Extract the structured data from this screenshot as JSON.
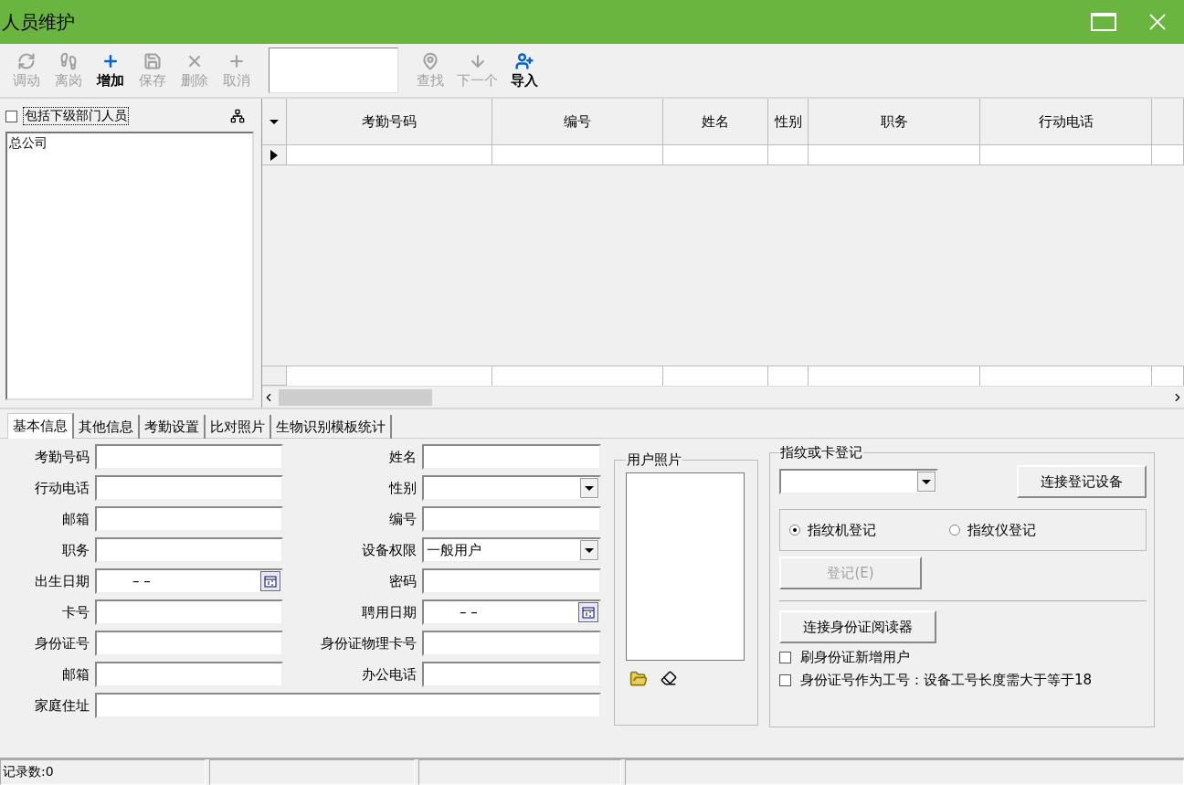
{
  "window": {
    "title": "人员维护"
  },
  "toolbar": {
    "buttons": [
      {
        "label": "调动",
        "disabled": true
      },
      {
        "label": "离岗",
        "disabled": true
      },
      {
        "label": "增加",
        "disabled": false
      },
      {
        "label": "保存",
        "disabled": true
      },
      {
        "label": "删除",
        "disabled": true
      },
      {
        "label": "取消",
        "disabled": true
      }
    ],
    "buttons_after_search": [
      {
        "label": "查找",
        "disabled": true
      },
      {
        "label": "下一个",
        "disabled": true
      },
      {
        "label": "导入",
        "disabled": false
      }
    ]
  },
  "department": {
    "include_sub": {
      "label": "包括下级部门人员",
      "checked": false
    },
    "tree": [
      {
        "label": "总公司",
        "selected": false
      }
    ]
  },
  "table": {
    "columns": [
      "考勤号码",
      "编号",
      "姓名",
      "性别",
      "职务",
      "行动电话"
    ],
    "rows": [
      {
        "selected": true
      }
    ]
  },
  "tabs": [
    {
      "label": "基本信息",
      "selected": true
    },
    {
      "label": "其他信息",
      "selected": false
    },
    {
      "label": "考勤设置",
      "selected": false
    },
    {
      "label": "比对照片",
      "selected": false
    },
    {
      "label": "生物识别模板统计",
      "selected": false
    }
  ],
  "form": {
    "fields": [
      {
        "label": "考勤号码",
        "kind": "text"
      },
      {
        "label": "姓名",
        "kind": "text"
      },
      {
        "label": "行动电话",
        "kind": "text"
      },
      {
        "label": "性别",
        "kind": "select"
      },
      {
        "label": "邮箱",
        "kind": "text"
      },
      {
        "label": "编号",
        "kind": "text"
      },
      {
        "label": "职务",
        "kind": "text"
      },
      {
        "label": "设备权限",
        "kind": "select",
        "value": "一般用户"
      },
      {
        "label": "出生日期",
        "kind": "date",
        "value": "–  –"
      },
      {
        "label": "密码",
        "kind": "text"
      },
      {
        "label": "卡号",
        "kind": "text"
      },
      {
        "label": "聘用日期",
        "kind": "date",
        "value": "–  –"
      },
      {
        "label": "身份证号",
        "kind": "text"
      },
      {
        "label": "身份证物理卡号",
        "kind": "text"
      },
      {
        "label": "邮箱",
        "kind": "text"
      },
      {
        "label": "办公电话",
        "kind": "text"
      },
      {
        "label": "家庭住址",
        "kind": "wide"
      }
    ]
  },
  "photo": {
    "title": "用户照片"
  },
  "enroll": {
    "title": "指纹或卡登记",
    "connect_button": "连接登记设备",
    "modes": [
      {
        "label": "指纹机登记",
        "selected": true
      },
      {
        "label": "指纹仪登记",
        "selected": false
      }
    ],
    "register_button": {
      "label": "登记(E)",
      "disabled": true
    },
    "id_reader_button": "连接身份证阅读器",
    "options": [
      {
        "label": "刷身份证新增用户",
        "checked": false
      },
      {
        "label": "身份证号作为工号：设备工号长度需大于等于18",
        "checked": false
      }
    ]
  },
  "status_bar": {
    "text": "记录数:0"
  }
}
